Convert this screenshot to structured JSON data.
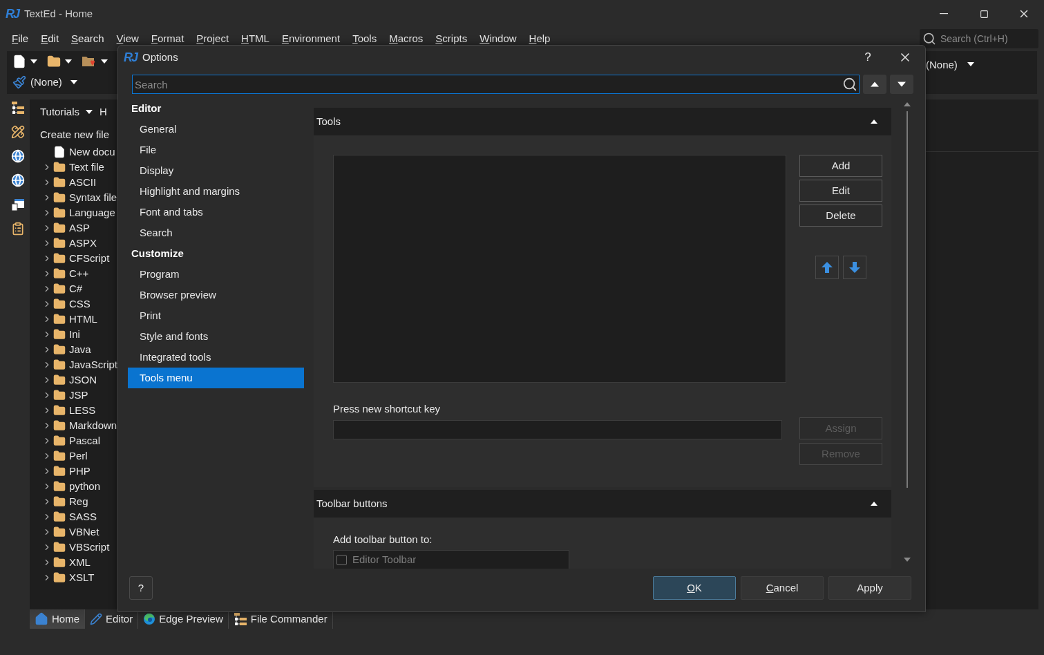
{
  "app": {
    "logo": "RJ",
    "title": "TextEd - Home"
  },
  "menu": {
    "access_keys_shown": true,
    "items": [
      "File",
      "Edit",
      "Search",
      "View",
      "Format",
      "Project",
      "HTML",
      "Environment",
      "Tools",
      "Macros",
      "Scripts",
      "Window",
      "Help"
    ]
  },
  "global_search": {
    "placeholder": "Search (Ctrl+H)"
  },
  "toolbar": {
    "left_dropdown": "(None)",
    "right_dropdown": "(None)"
  },
  "side_panel": {
    "tabs": [
      {
        "label": "Tutorials",
        "kind": "dropdown"
      },
      {
        "label": "H",
        "kind": "tab"
      }
    ],
    "heading": "Create new file",
    "tree": [
      {
        "label": "New docu",
        "kind": "file"
      },
      {
        "label": "Text file",
        "kind": "folder",
        "expanded": false
      },
      {
        "label": "ASCII",
        "kind": "folder",
        "expanded": false
      },
      {
        "label": "Syntax file",
        "kind": "folder",
        "expanded": false
      },
      {
        "label": "Language",
        "kind": "folder",
        "expanded": false
      },
      {
        "label": "ASP",
        "kind": "folder",
        "expanded": false
      },
      {
        "label": "ASPX",
        "kind": "folder",
        "expanded": false
      },
      {
        "label": "CFScript",
        "kind": "folder",
        "expanded": false
      },
      {
        "label": "C++",
        "kind": "folder",
        "expanded": false
      },
      {
        "label": "C#",
        "kind": "folder",
        "expanded": false
      },
      {
        "label": "CSS",
        "kind": "folder",
        "expanded": false
      },
      {
        "label": "HTML",
        "kind": "folder",
        "expanded": false
      },
      {
        "label": "Ini",
        "kind": "folder",
        "expanded": false
      },
      {
        "label": "Java",
        "kind": "folder",
        "expanded": false
      },
      {
        "label": "JavaScript",
        "kind": "folder",
        "expanded": false
      },
      {
        "label": "JSON",
        "kind": "folder",
        "expanded": false
      },
      {
        "label": "JSP",
        "kind": "folder",
        "expanded": false
      },
      {
        "label": "LESS",
        "kind": "folder",
        "expanded": false
      },
      {
        "label": "Markdown",
        "kind": "folder",
        "expanded": false
      },
      {
        "label": "Pascal",
        "kind": "folder",
        "expanded": false
      },
      {
        "label": "Perl",
        "kind": "folder",
        "expanded": false
      },
      {
        "label": "PHP",
        "kind": "folder",
        "expanded": false
      },
      {
        "label": "python",
        "kind": "folder",
        "expanded": false
      },
      {
        "label": "Reg",
        "kind": "folder",
        "expanded": false
      },
      {
        "label": "SASS",
        "kind": "folder",
        "expanded": false
      },
      {
        "label": "VBNet",
        "kind": "folder",
        "expanded": false
      },
      {
        "label": "VBScript",
        "kind": "folder",
        "expanded": false
      },
      {
        "label": "XML",
        "kind": "folder",
        "expanded": false
      },
      {
        "label": "XSLT",
        "kind": "folder",
        "expanded": false
      }
    ]
  },
  "bottom_tabs": [
    {
      "label": "Home",
      "selected": true
    },
    {
      "label": "Editor",
      "selected": false
    },
    {
      "label": "Edge Preview",
      "selected": false
    },
    {
      "label": "File Commander",
      "selected": false
    }
  ],
  "dialog": {
    "logo": "RJ",
    "title": "Options",
    "help": "?",
    "search": {
      "placeholder": "Search"
    },
    "nav": [
      {
        "label": "Editor",
        "selected": false,
        "children": [
          {
            "label": "General",
            "selected": false
          },
          {
            "label": "File",
            "selected": false
          },
          {
            "label": "Display",
            "selected": false
          },
          {
            "label": "Highlight and margins",
            "selected": false
          },
          {
            "label": "Font and tabs",
            "selected": false
          },
          {
            "label": "Search",
            "selected": false
          }
        ]
      },
      {
        "label": "Customize",
        "selected": false,
        "children": [
          {
            "label": "Program",
            "selected": false
          },
          {
            "label": "Browser preview",
            "selected": false
          },
          {
            "label": "Print",
            "selected": false
          },
          {
            "label": "Style and fonts",
            "selected": false
          },
          {
            "label": "Integrated tools",
            "selected": false
          },
          {
            "label": "Tools menu",
            "selected": true
          }
        ]
      }
    ],
    "sections": [
      {
        "kind": "tools",
        "title": "Tools",
        "expanded": true,
        "buttons": [
          {
            "label": "Add",
            "disabled": false
          },
          {
            "label": "Edit",
            "disabled": false
          },
          {
            "label": "Delete",
            "disabled": false
          }
        ],
        "shortcut_label": "Press new shortcut key",
        "shortcut_buttons": [
          {
            "label": "Assign",
            "disabled": true
          },
          {
            "label": "Remove",
            "disabled": true
          }
        ]
      },
      {
        "kind": "toolbar",
        "title": "Toolbar buttons",
        "expanded": true,
        "label": "Add toolbar button to:",
        "targets": [
          {
            "label": "Editor Toolbar",
            "checked": false,
            "disabled": true
          }
        ]
      }
    ],
    "footer": {
      "help": "?",
      "buttons": [
        {
          "label": "OK",
          "mnemonic": true,
          "default": true
        },
        {
          "label": "Cancel",
          "mnemonic": true,
          "default": false
        },
        {
          "label": "Apply",
          "mnemonic": false,
          "default": false
        }
      ]
    }
  }
}
